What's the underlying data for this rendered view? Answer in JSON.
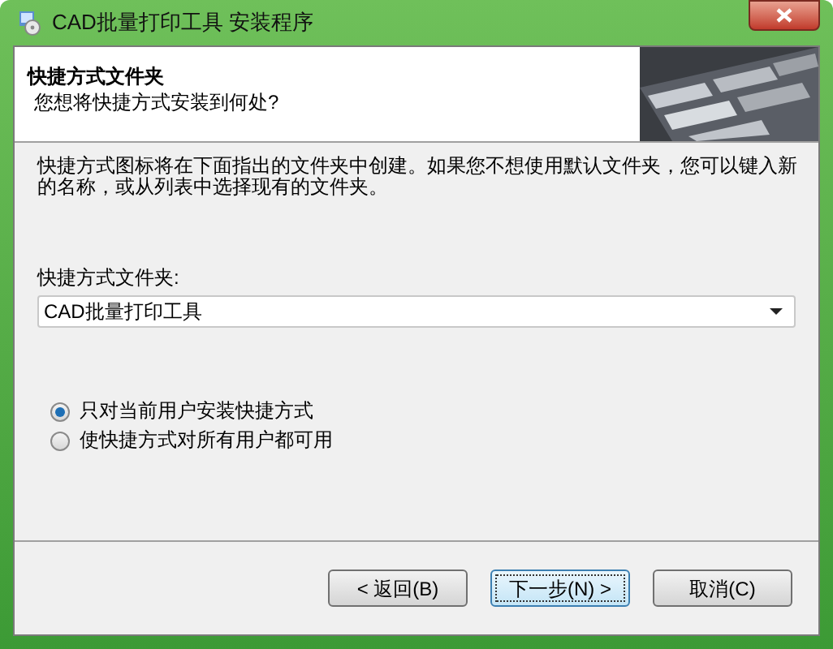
{
  "window": {
    "title": "CAD批量打印工具 安装程序"
  },
  "header": {
    "title": "快捷方式文件夹",
    "subtitle": "您想将快捷方式安装到何处?"
  },
  "description": "快捷方式图标将在下面指出的文件夹中创建。如果您不想使用默认文件夹，您可以键入新的名称，或从列表中选择现有的文件夹。",
  "folder": {
    "label": "快捷方式文件夹:",
    "value": "CAD批量打印工具"
  },
  "options": [
    {
      "label": "只对当前用户安装快捷方式",
      "selected": true
    },
    {
      "label": "使快捷方式对所有用户都可用",
      "selected": false
    }
  ],
  "buttons": [
    {
      "label": "< 返回(B)",
      "default": false
    },
    {
      "label": "下一步(N) >",
      "default": true
    },
    {
      "label": "取消(C)",
      "default": false
    }
  ]
}
